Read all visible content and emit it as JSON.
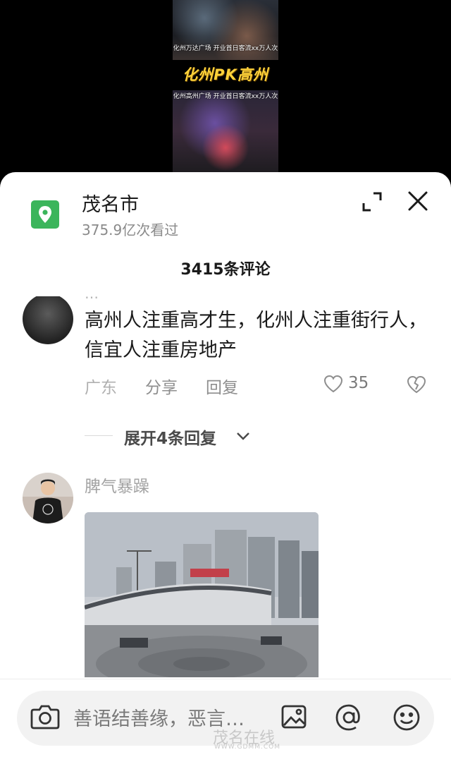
{
  "video": {
    "caption_top": "化州万达广场 开业首日客流xx万人次",
    "vs_title": "化州PK高州",
    "caption_bottom": "化州高州广场 开业首日客流xx万人次"
  },
  "location": {
    "title": "茂名市",
    "views": "375.9亿次看过",
    "comment_count": "3415条评论"
  },
  "comments": [
    {
      "partial_name": "…",
      "text": "高州人注重高才生，化州人注重街行人，信宜人注重房地产",
      "region": "广东",
      "share": "分享",
      "reply": "回复",
      "likes": "35",
      "expand_replies": "展开4条回复"
    },
    {
      "username": "脾气暴躁"
    }
  ],
  "input": {
    "placeholder": "善语结善缘，恶言…"
  },
  "watermark": {
    "text": "茂名在线",
    "sub": "WWW.GDMM.COM"
  },
  "colors": {
    "accent_green": "#3bb55b",
    "gold_title": "#ffd23a"
  },
  "icons": [
    "location-pin-icon",
    "expand-icon",
    "close-icon",
    "heart-icon",
    "broken-heart-icon",
    "chevron-down-icon",
    "camera-icon",
    "image-icon",
    "at-icon",
    "emoji-icon"
  ]
}
